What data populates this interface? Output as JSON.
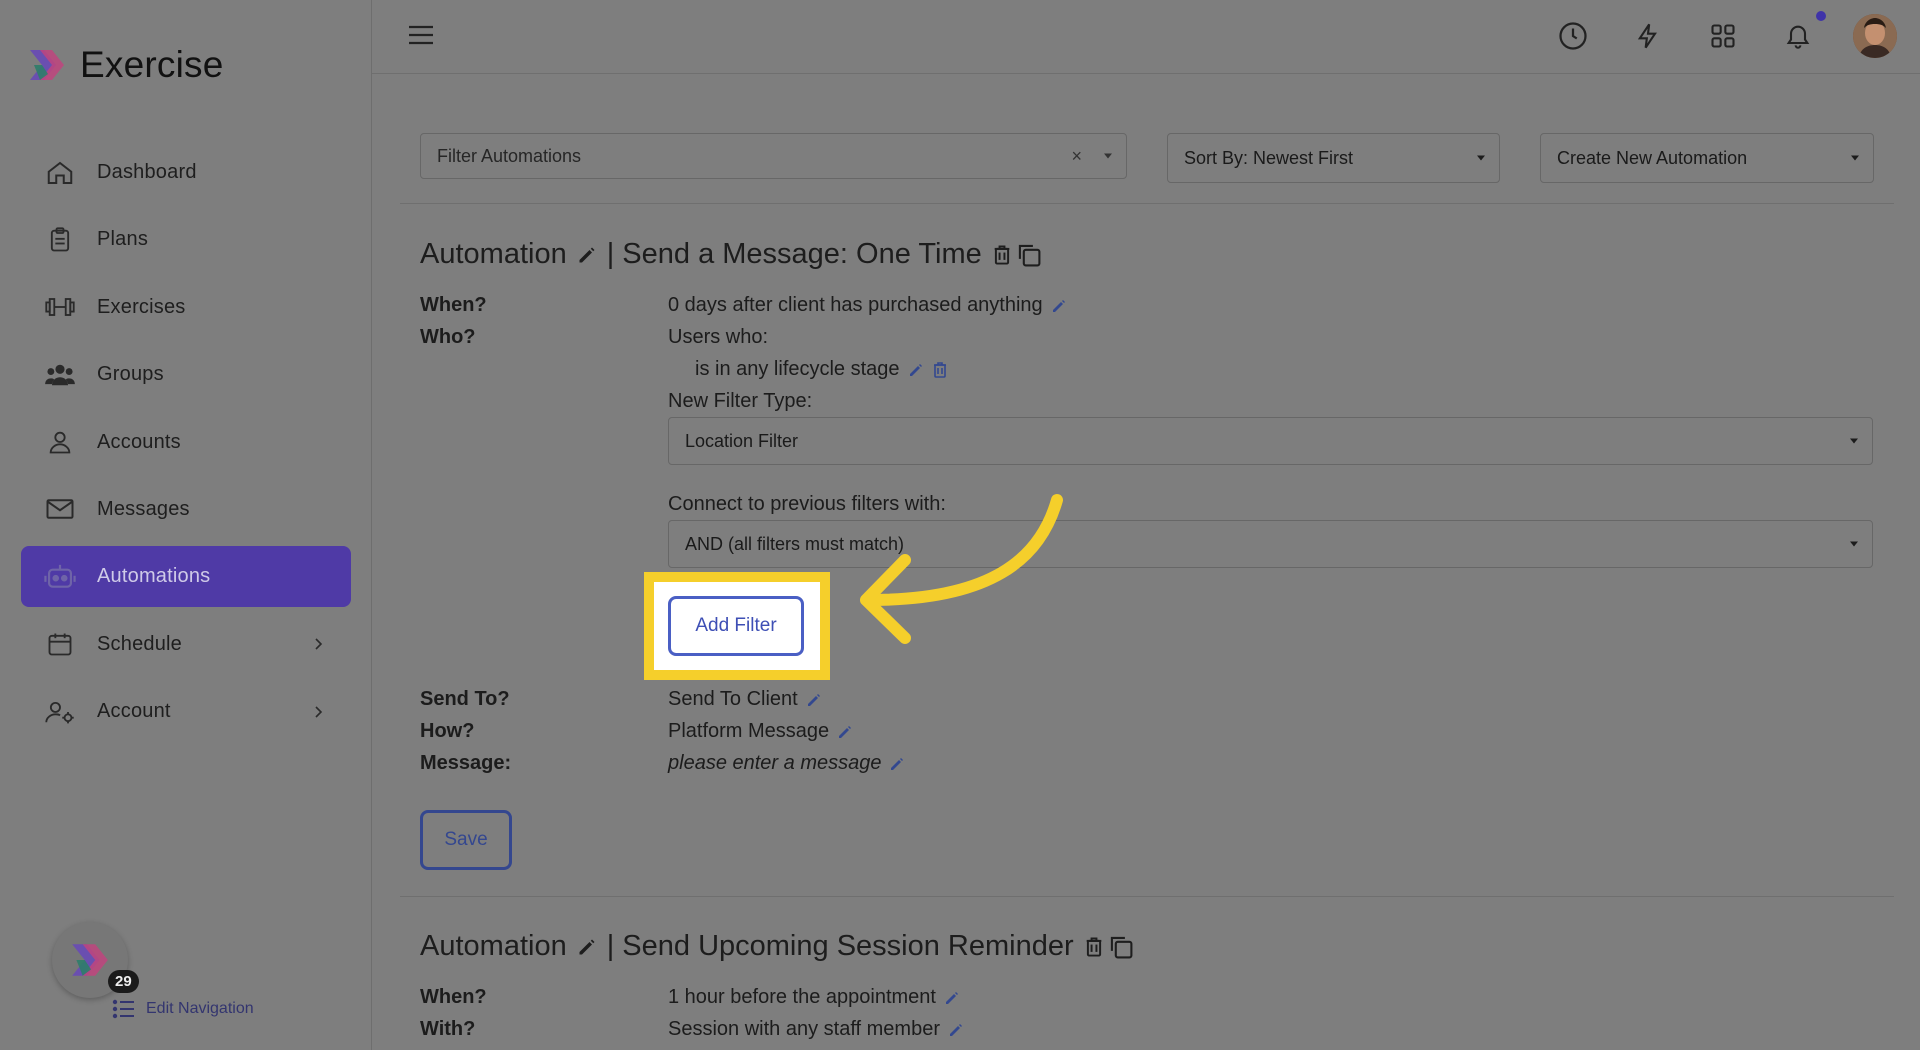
{
  "brand": {
    "name": "Exercise"
  },
  "sidebar": {
    "items": [
      {
        "label": "Dashboard",
        "icon": "home-icon"
      },
      {
        "label": "Plans",
        "icon": "clipboard-icon"
      },
      {
        "label": "Exercises",
        "icon": "dumbbell-icon"
      },
      {
        "label": "Groups",
        "icon": "users-icon"
      },
      {
        "label": "Accounts",
        "icon": "user-icon"
      },
      {
        "label": "Messages",
        "icon": "mail-icon"
      },
      {
        "label": "Automations",
        "icon": "robot-icon",
        "active": true
      },
      {
        "label": "Schedule",
        "icon": "calendar-icon",
        "has_children": true
      },
      {
        "label": "Account",
        "icon": "user-gear-icon",
        "has_children": true
      }
    ],
    "badge_count": "29",
    "edit_navigation": "Edit Navigation"
  },
  "toolbar": {
    "filter_placeholder": "Filter Automations",
    "sort_label": "Sort By: Newest First",
    "create_label": "Create New Automation"
  },
  "automation1": {
    "title_prefix": "Automation",
    "title_sep": "| Send a Message: One Time",
    "when_label": "When?",
    "when_value": "0 days after client has purchased anything",
    "who_label": "Who?",
    "who_value": "Users who:",
    "filter_item": "is in any lifecycle stage",
    "new_filter_type_label": "New Filter Type:",
    "new_filter_type_value": "Location Filter",
    "connect_label": "Connect to previous filters with:",
    "connect_value": "AND (all filters must match)",
    "add_filter_button": "Add Filter",
    "send_to_label": "Send To?",
    "send_to_value": "Send To Client",
    "how_label": "How?",
    "how_value": "Platform Message",
    "message_label": "Message:",
    "message_value": "please enter a message",
    "save_button": "Save"
  },
  "automation2": {
    "title_prefix": "Automation",
    "title_sep": "| Send Upcoming Session Reminder",
    "when_label": "When?",
    "when_value": "1 hour before the appointment",
    "with_label": "With?",
    "with_value": "Session with any staff member"
  },
  "colors": {
    "active_nav": "#4f3aa6",
    "highlight": "#f5cf2b",
    "button_blue": "#4a5fc4"
  }
}
